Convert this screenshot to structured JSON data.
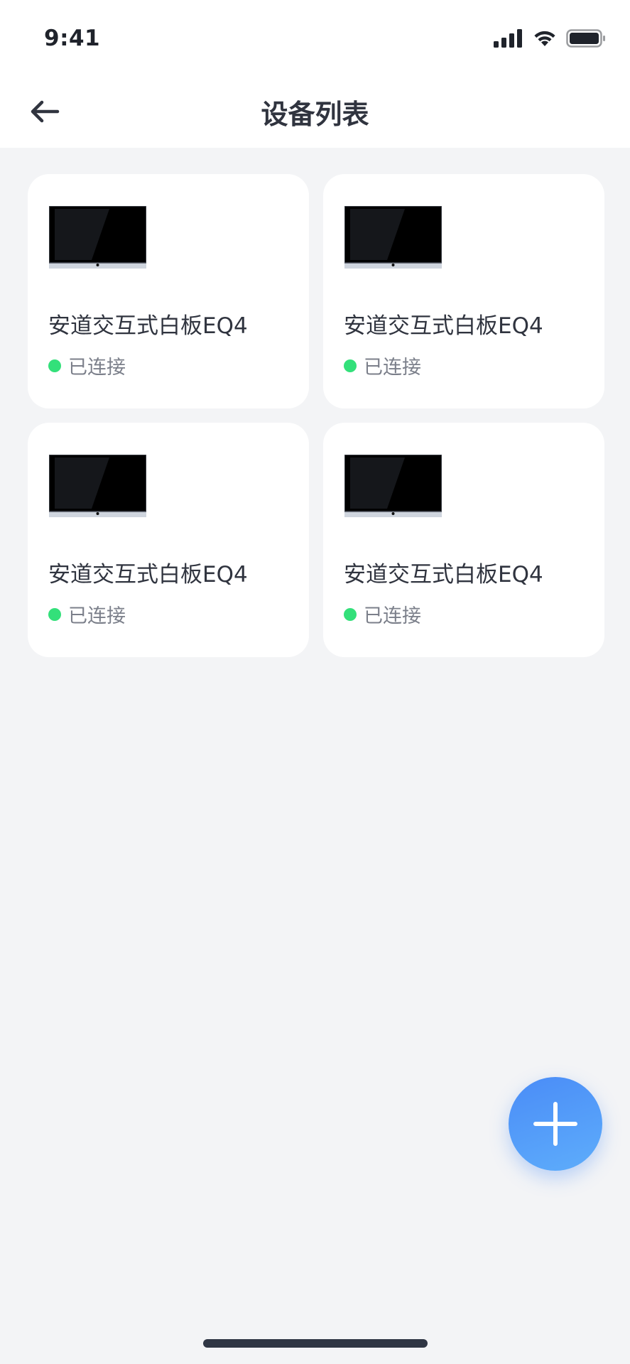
{
  "status_bar": {
    "time": "9:41",
    "icons": [
      "cellular-signal-icon",
      "wifi-icon",
      "battery-icon"
    ]
  },
  "header": {
    "title": "设备列表",
    "back_icon": "arrow-left-icon"
  },
  "devices": [
    {
      "name": "安道交互式白板EQ4",
      "status": "已连接",
      "status_color": "#33e07a"
    },
    {
      "name": "安道交互式白板EQ4",
      "status": "已连接",
      "status_color": "#33e07a"
    },
    {
      "name": "安道交互式白板EQ4",
      "status": "已连接",
      "status_color": "#33e07a"
    },
    {
      "name": "安道交互式白板EQ4",
      "status": "已连接",
      "status_color": "#33e07a"
    }
  ],
  "fab": {
    "icon": "plus-icon",
    "color": "#4a8cf7"
  },
  "colors": {
    "background": "#f3f4f6",
    "card": "#ffffff",
    "text_primary": "#30343f",
    "text_secondary": "#7b7f8a",
    "connected": "#33e07a"
  }
}
